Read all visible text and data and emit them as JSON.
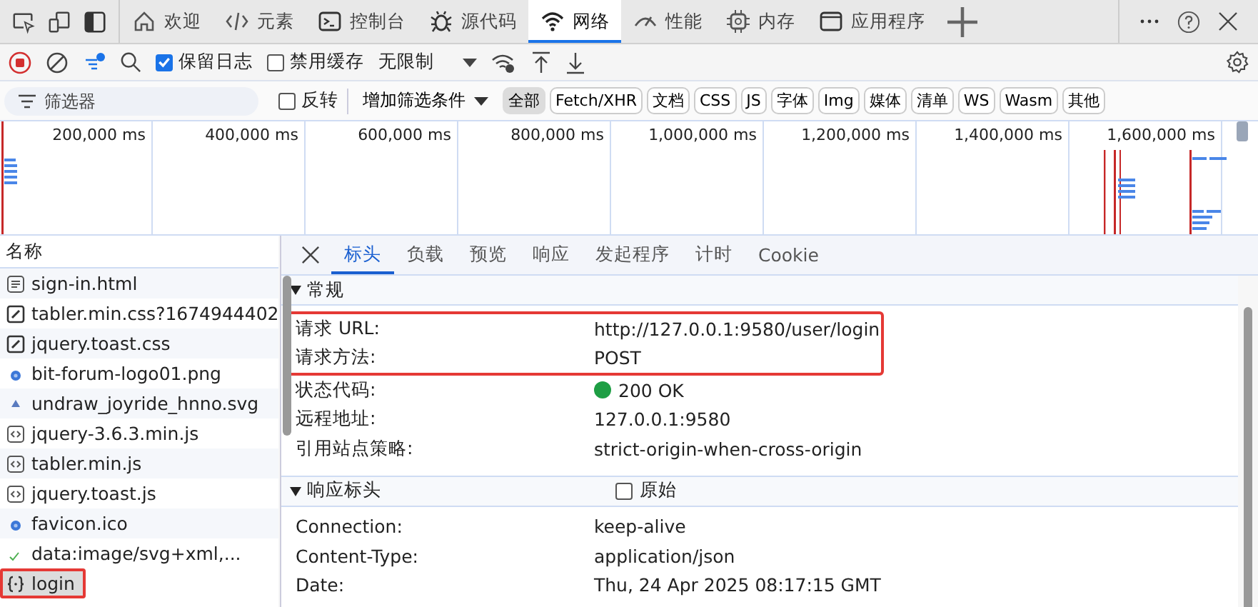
{
  "tabs": [
    {
      "kind": "home",
      "label": "欢迎",
      "selected": false
    },
    {
      "kind": "code",
      "label": "元素",
      "selected": false
    },
    {
      "kind": "console",
      "label": "控制台",
      "selected": false
    },
    {
      "kind": "bug",
      "label": "源代码",
      "selected": false
    },
    {
      "kind": "wifi",
      "label": "网络",
      "selected": true
    },
    {
      "kind": "gauge",
      "label": "性能",
      "selected": false
    },
    {
      "kind": "chip",
      "label": "内存",
      "selected": false
    },
    {
      "kind": "window",
      "label": "应用程序",
      "selected": false
    }
  ],
  "toolbar": {
    "checkboxes": [
      {
        "label": "保留日志",
        "checked": true
      },
      {
        "label": "禁用缓存",
        "checked": false
      }
    ],
    "throttle": "无限制"
  },
  "filter": {
    "placeholder": "筛选器",
    "invert": {
      "label": "反转",
      "checked": false
    },
    "more": "增加筛选条件",
    "chips": [
      {
        "label": "全部",
        "selected": true
      },
      {
        "label": "Fetch/XHR",
        "selected": false
      },
      {
        "label": "文档",
        "selected": false
      },
      {
        "label": "CSS",
        "selected": false
      },
      {
        "label": "JS",
        "selected": false
      },
      {
        "label": "字体",
        "selected": false
      },
      {
        "label": "Img",
        "selected": false
      },
      {
        "label": "媒体",
        "selected": false
      },
      {
        "label": "清单",
        "selected": false
      },
      {
        "label": "WS",
        "selected": false
      },
      {
        "label": "Wasm",
        "selected": false
      },
      {
        "label": "其他",
        "selected": false
      }
    ]
  },
  "timeline": {
    "ticks": [
      "200,000 ms",
      "400,000 ms",
      "600,000 ms",
      "800,000 ms",
      "1,000,000 ms",
      "1,200,000 ms",
      "1,400,000 ms",
      "1,600,000 ms"
    ]
  },
  "requests": {
    "header": "名称",
    "items": [
      {
        "kind": "doc",
        "name": "sign-in.html",
        "selected": false,
        "highlighted": false
      },
      {
        "kind": "css",
        "name": "tabler.min.css?1674944402",
        "selected": false,
        "highlighted": false
      },
      {
        "kind": "css",
        "name": "jquery.toast.css",
        "selected": false,
        "highlighted": false
      },
      {
        "kind": "image",
        "name": "bit-forum-logo01.png",
        "selected": false,
        "highlighted": false
      },
      {
        "kind": "svg",
        "name": "undraw_joyride_hnno.svg",
        "selected": false,
        "highlighted": false
      },
      {
        "kind": "script",
        "name": "jquery-3.6.3.min.js",
        "selected": false,
        "highlighted": false
      },
      {
        "kind": "script",
        "name": "tabler.min.js",
        "selected": false,
        "highlighted": false
      },
      {
        "kind": "script",
        "name": "jquery.toast.js",
        "selected": false,
        "highlighted": false
      },
      {
        "kind": "image",
        "name": "favicon.ico",
        "selected": false,
        "highlighted": false
      },
      {
        "kind": "data",
        "name": "data:image/svg+xml,...",
        "selected": false,
        "highlighted": false
      },
      {
        "kind": "fetch",
        "name": "login",
        "selected": true,
        "highlighted": true
      }
    ]
  },
  "detail_tabs": [
    {
      "label": "标头",
      "selected": true
    },
    {
      "label": "负载",
      "selected": false
    },
    {
      "label": "预览",
      "selected": false
    },
    {
      "label": "响应",
      "selected": false
    },
    {
      "label": "发起程序",
      "selected": false
    },
    {
      "label": "计时",
      "selected": false
    },
    {
      "label": "Cookie",
      "selected": false
    }
  ],
  "general": {
    "title": "常规",
    "expanded": true,
    "rows": [
      {
        "kind": "text",
        "label": "请求 URL:",
        "value": "http://127.0.0.1:9580/user/login",
        "highlighted": true
      },
      {
        "kind": "text",
        "label": "请求方法:",
        "value": "POST",
        "highlighted": true
      },
      {
        "kind": "status",
        "label": "状态代码:",
        "value": "200 OK",
        "highlighted": false
      },
      {
        "kind": "text",
        "label": "远程地址:",
        "value": "127.0.0.1:9580",
        "highlighted": false
      },
      {
        "kind": "text",
        "label": "引用站点策略:",
        "value": "strict-origin-when-cross-origin",
        "highlighted": false
      }
    ]
  },
  "response_headers": {
    "title": "响应标头",
    "expanded": true,
    "raw": {
      "label": "原始",
      "checked": false
    },
    "rows": [
      {
        "label": "Connection:",
        "value": "keep-alive"
      },
      {
        "label": "Content-Type:",
        "value": "application/json"
      },
      {
        "label": "Date:",
        "value": "Thu, 24 Apr 2025 08:17:15 GMT"
      }
    ]
  }
}
